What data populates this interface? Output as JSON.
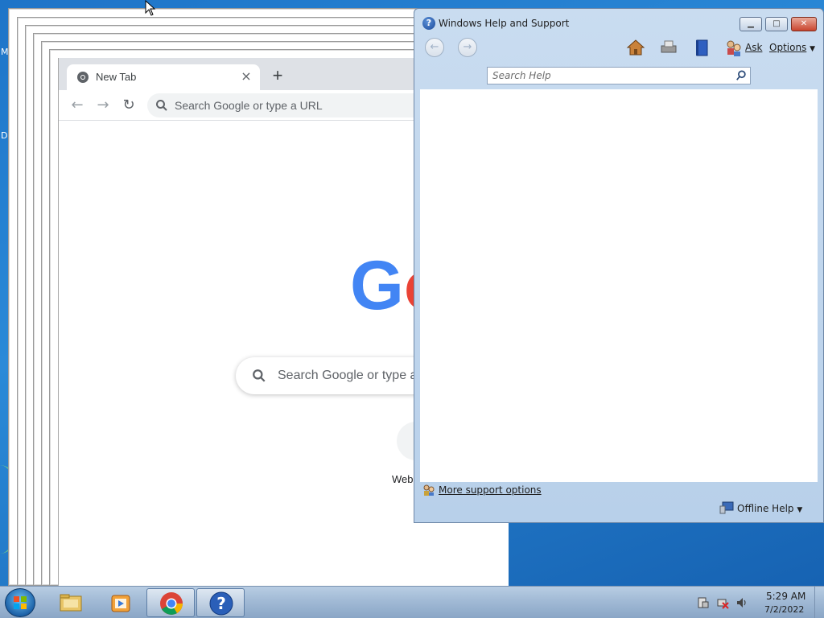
{
  "desktop": {
    "letters": [
      "M",
      "D"
    ]
  },
  "chrome": {
    "tab_title": "New Tab",
    "new_tab_symbol": "+",
    "close_symbol": "×",
    "back_symbol": "←",
    "forward_symbol": "→",
    "reload_symbol": "↻",
    "omnibox_placeholder": "Search Google or type a URL",
    "logo_visible": "Go",
    "ntp_search_placeholder": "Search Google or type a URL",
    "shortcut_label": "Web"
  },
  "help_window": {
    "title": "Windows Help and Support",
    "title_icon": "?",
    "minimize_symbol": "▁",
    "maximize_symbol": "□",
    "close_symbol": "✕",
    "toolbar": {
      "back_icon": "back-arrow-icon",
      "forward_icon": "forward-arrow-icon",
      "home_icon": "home-icon",
      "print_icon": "printer-icon",
      "browse_icon": "book-icon",
      "ask_label": "Ask",
      "options_label": "Options",
      "dropdown_symbol": "▼"
    },
    "search_placeholder": "Search Help",
    "footer": {
      "more_support_label": "More support options",
      "offline_help_label": "Offline Help",
      "dropdown_symbol": "▼"
    }
  },
  "taskbar": {
    "pinned": [
      {
        "name": "windows-explorer",
        "icon": "folder-icon"
      },
      {
        "name": "media-player",
        "icon": "media-player-icon"
      },
      {
        "name": "chrome",
        "icon": "chrome-icon"
      },
      {
        "name": "help-and-support",
        "icon": "help-icon"
      }
    ],
    "clock_time": "5:29 AM",
    "clock_date": "7/2/2022"
  },
  "colors": {
    "desktop_blue": "#1e74c8",
    "google_blue": "#4285f4",
    "google_red": "#ea4335",
    "taskbar": "#9fb8d4"
  }
}
